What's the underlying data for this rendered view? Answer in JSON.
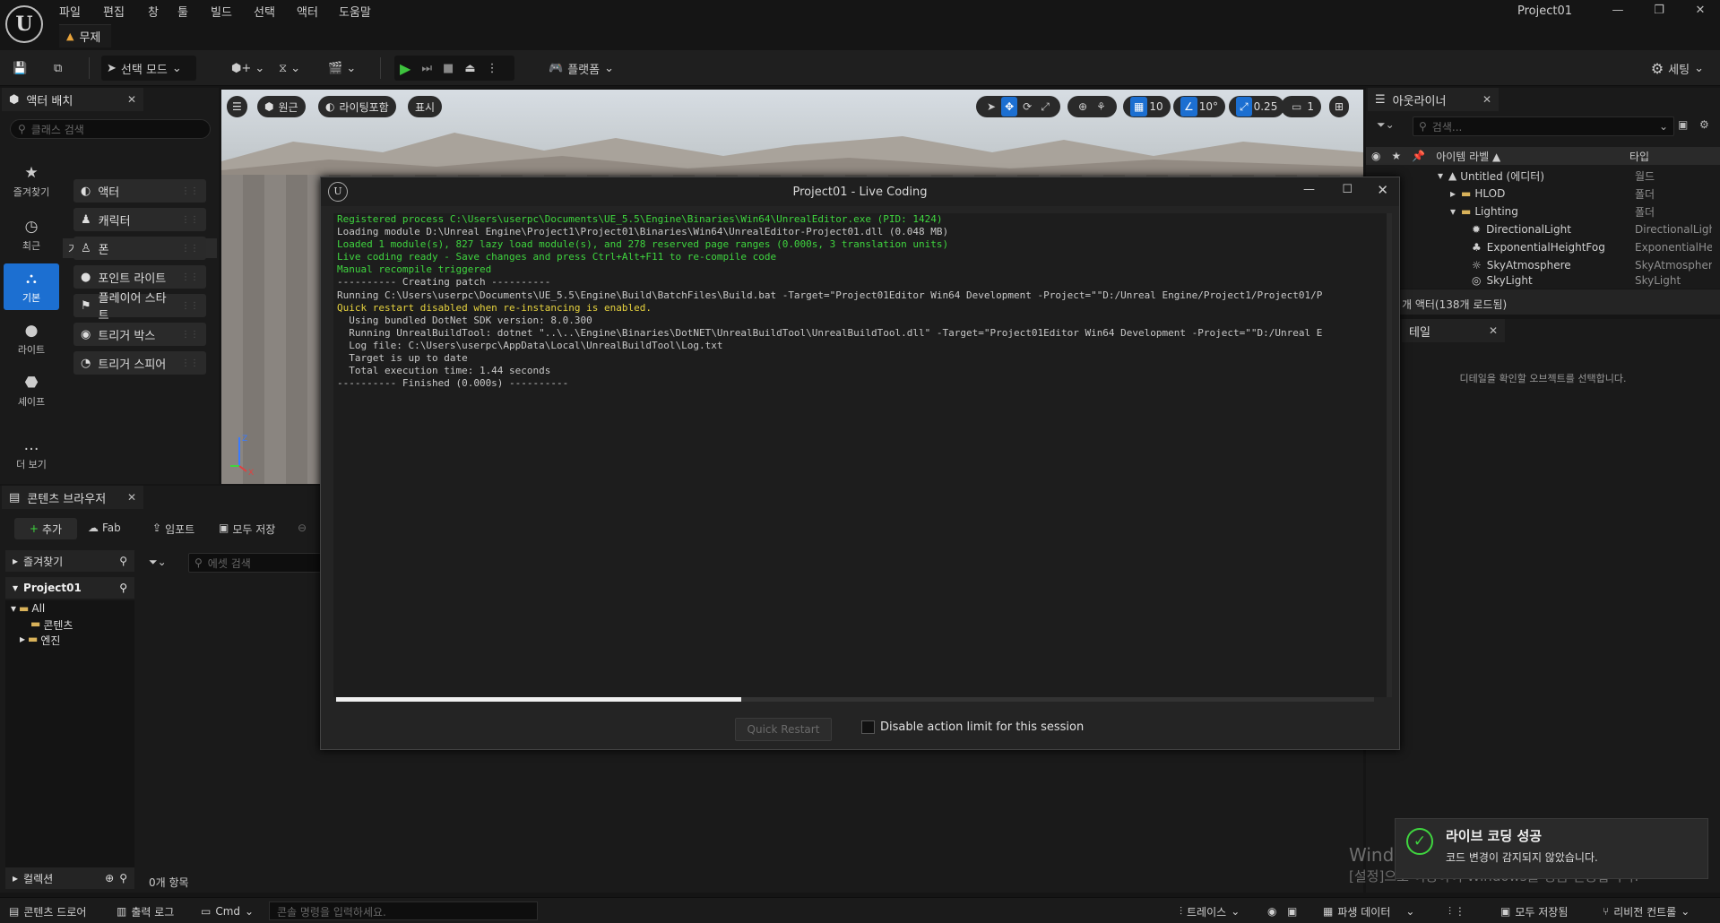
{
  "app": {
    "logo": "U",
    "project_name": "Project01",
    "doc_tab": "무제"
  },
  "menu": [
    "파일",
    "편집",
    "창",
    "툴",
    "빌드",
    "선택",
    "액터",
    "도움말"
  ],
  "toolbar": {
    "select_mode": "선택 모드",
    "platforms": "플랫폼",
    "settings": "세팅"
  },
  "place_actors": {
    "tab": "액터 배치",
    "search_placeholder": "클래스 검색",
    "categories": [
      {
        "label": "즐겨찾기",
        "icon": "star-icon"
      },
      {
        "label": "최근",
        "icon": "clock-icon"
      },
      {
        "label": "기본",
        "icon": "shapes-icon"
      },
      {
        "label": "라이트",
        "icon": "bulb-icon"
      },
      {
        "label": "셰이프",
        "icon": "cube-icon"
      },
      {
        "label": "더 보기",
        "icon": "more-icon"
      }
    ],
    "section": "기본",
    "items": [
      "액터",
      "캐릭터",
      "폰",
      "포인트 라이트",
      "플레이어 스타트",
      "트리거 박스",
      "트리거 스피어"
    ]
  },
  "viewport": {
    "perspective": "원근",
    "lit": "라이팅포함",
    "show": "표시",
    "grid": "10",
    "angle": "10°",
    "scale": "0.25",
    "camera": "1",
    "colors": {
      "accent": "#1c6fd1"
    }
  },
  "outliner": {
    "tab": "아웃라이너",
    "search_placeholder": "검색...",
    "col_label": "아이템 라벨 ▲",
    "col_type": "타입",
    "rows": [
      {
        "label": "Untitled (에디터)",
        "type": "월드"
      },
      {
        "label": "HLOD",
        "type": "폴더"
      },
      {
        "label": "Lighting",
        "type": "폴더"
      },
      {
        "label": "DirectionalLight",
        "type": "DirectionalLight"
      },
      {
        "label": "ExponentialHeightFog",
        "type": "ExponentialHeightFog"
      },
      {
        "label": "SkyAtmosphere",
        "type": "SkyAtmosphere"
      },
      {
        "label": "SkyLight",
        "type": "SkyLight"
      }
    ],
    "footer": "개 액터(138개 로드됨)"
  },
  "details": {
    "tab": "테일",
    "empty": "디테일을 확인할 오브젝트를 선택합니다."
  },
  "content_browser": {
    "tab": "콘텐츠 브라우저",
    "add": "추가",
    "fab": "Fab",
    "import": "임포트",
    "save_all": "모두 저장",
    "favorites": "즐겨찾기",
    "project": "Project01",
    "tree": [
      "All",
      "콘텐츠",
      "엔진"
    ],
    "search_placeholder": "에셋 검색",
    "collections": "컬렉션",
    "count": "0개 항목"
  },
  "live_coding": {
    "title": "Project01 - Live Coding",
    "log": [
      {
        "c": "g",
        "t": "Registered process C:\\Users\\userpc\\Documents\\UE_5.5\\Engine\\Binaries\\Win64\\UnrealEditor.exe (PID: 1424)"
      },
      {
        "c": "w",
        "t": "Loading module D:\\Unreal Engine\\Project1\\Project01\\Binaries\\Win64\\UnrealEditor-Project01.dll (0.048 MB)"
      },
      {
        "c": "g",
        "t": "Loaded 1 module(s), 827 lazy load module(s), and 278 reserved page ranges (0.000s, 3 translation units)"
      },
      {
        "c": "g",
        "t": "Live coding ready - Save changes and press Ctrl+Alt+F11 to re-compile code"
      },
      {
        "c": "g",
        "t": "Manual recompile triggered"
      },
      {
        "c": "w",
        "t": "---------- Creating patch ----------"
      },
      {
        "c": "w",
        "t": "Running C:\\Users\\userpc\\Documents\\UE_5.5\\Engine\\Build\\BatchFiles\\Build.bat -Target=\"Project01Editor Win64 Development -Project=\"\"D:/Unreal Engine/Project1/Project01/P"
      },
      {
        "c": "y",
        "t": "Quick restart disabled when re-instancing is enabled."
      },
      {
        "c": "w",
        "t": "  Using bundled DotNet SDK version: 8.0.300"
      },
      {
        "c": "w",
        "t": "  Running UnrealBuildTool: dotnet \"..\\..\\Engine\\Binaries\\DotNET\\UnrealBuildTool\\UnrealBuildTool.dll\" -Target=\"Project01Editor Win64 Development -Project=\"\"D:/Unreal E"
      },
      {
        "c": "w",
        "t": "  Log file: C:\\Users\\userpc\\AppData\\Local\\UnrealBuildTool\\Log.txt"
      },
      {
        "c": "w",
        "t": "  Target is up to date"
      },
      {
        "c": "w",
        "t": "  Total execution time: 1.44 seconds"
      },
      {
        "c": "w",
        "t": "---------- Finished (0.000s) ----------"
      }
    ],
    "progress": 0.39,
    "quick_restart": "Quick Restart",
    "disable_limit": "Disable action limit for this session"
  },
  "toast": {
    "title": "라이브 코딩 성공",
    "message": "코드 변경이 감지되지 않았습니다."
  },
  "watermark": {
    "line1": "Windows 정품 인증",
    "line2": "[설정]으로 이동하여 Windows를 정품 인증합니다."
  },
  "statusbar": {
    "drawer": "콘텐츠 드로어",
    "output_log": "출력 로그",
    "cmd": "Cmd",
    "cmd_placeholder": "콘솔 명령을 입력하세요.",
    "trace": "트레이스",
    "derived": "파생 데이터",
    "saved": "모두 저장됨",
    "revision": "리비전 컨트롤"
  }
}
